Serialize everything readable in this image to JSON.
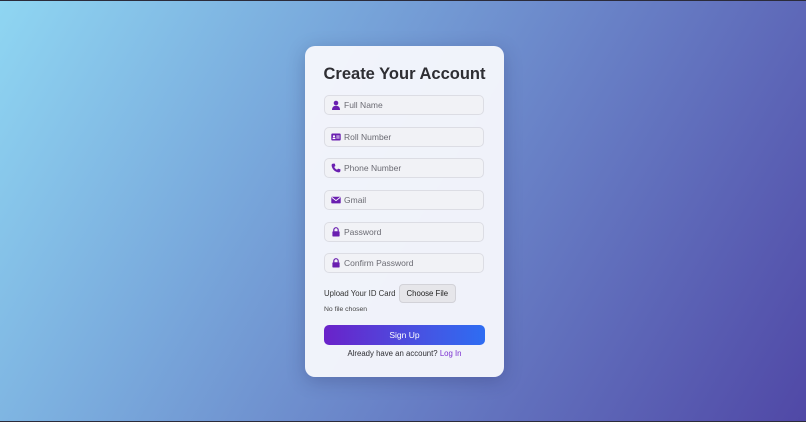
{
  "form": {
    "title": "Create Your Account",
    "fields": [
      {
        "icon": "user-icon",
        "placeholder": "Full Name",
        "value": ""
      },
      {
        "icon": "id-card-icon",
        "placeholder": "Roll Number",
        "value": ""
      },
      {
        "icon": "phone-icon",
        "placeholder": "Phone Number",
        "value": ""
      },
      {
        "icon": "envelope-icon",
        "placeholder": "Gmail",
        "value": ""
      },
      {
        "icon": "lock-icon",
        "placeholder": "Password",
        "value": ""
      },
      {
        "icon": "lock-icon",
        "placeholder": "Confirm Password",
        "value": ""
      }
    ],
    "upload": {
      "label": "Upload Your ID Card",
      "button_label": "Choose File",
      "status": "No file chosen"
    },
    "submit_label": "Sign Up",
    "login_prompt": "Already have an account?",
    "login_link": "Log In"
  },
  "colors": {
    "accent": "#6a22c9",
    "icon": "#6a1fb0",
    "button_start": "#6a22c9",
    "button_end": "#2e6df2",
    "link": "#7a2fd0"
  }
}
